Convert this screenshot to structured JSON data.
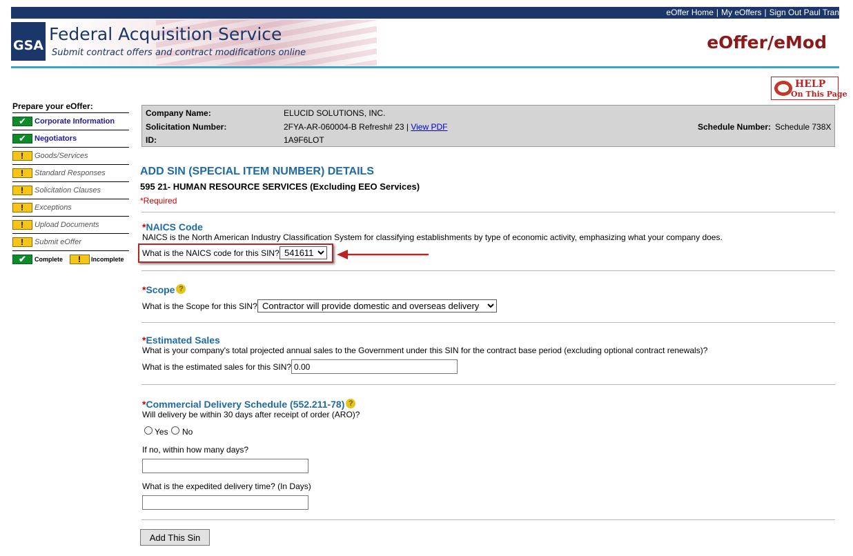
{
  "toplinks": {
    "home": "eOffer Home",
    "my": "My eOffers",
    "signout": "Sign Out Paul Tran"
  },
  "banner": {
    "logo": "GSA",
    "title": "Federal Acquisition Service",
    "subtitle": "Submit contract offers and contract modifications online",
    "brand": "eOffer/eMod"
  },
  "help": {
    "line1": "HELP",
    "line2": "On This Page"
  },
  "sidebar": {
    "title": "Prepare your eOffer:",
    "items": [
      {
        "label": "Corporate Information",
        "status": "complete"
      },
      {
        "label": "Negotiators",
        "status": "complete"
      },
      {
        "label": "Goods/Services",
        "status": "incomplete"
      },
      {
        "label": "Standard Responses",
        "status": "incomplete"
      },
      {
        "label": "Solicitation Clauses",
        "status": "incomplete"
      },
      {
        "label": "Exceptions",
        "status": "incomplete"
      },
      {
        "label": "Upload Documents",
        "status": "incomplete"
      },
      {
        "label": "Submit eOffer",
        "status": "incomplete"
      }
    ],
    "legend_complete": "Complete",
    "legend_incomplete": "Incomplete"
  },
  "info": {
    "company_label": "Company Name:",
    "company_value": "ELUCID SOLUTIONS, INC.",
    "solicitation_label": "Solicitation Number:",
    "solicitation_value": "2FYA-AR-060004-B Refresh# 23 |",
    "view_pdf": "View PDF",
    "id_label": "ID:",
    "id_value": "1A9F6LOT",
    "schedule_label": "Schedule Number:",
    "schedule_value": "Schedule 738X"
  },
  "main": {
    "title": "ADD SIN (SPECIAL ITEM NUMBER) DETAILS",
    "sin_title": "595 21- HUMAN RESOURCE SERVICES (Excluding EEO Services)",
    "required_note": "*Required"
  },
  "naics": {
    "heading": "NAICS Code",
    "description": "NAICS is the North American Industry Classification System for classifying establishments by type of economic activity, emphasizing what your company does.",
    "question": "What is the NAICS code for this SIN?",
    "selected": "541611"
  },
  "scope": {
    "heading": "Scope",
    "question": "What is the Scope for this SIN?",
    "selected": "Contractor will provide domestic and overseas delivery"
  },
  "sales": {
    "heading": "Estimated Sales",
    "description": "What is your company's total projected annual sales to the Government under this SIN for the contract base period (excluding optional contract renewals)?",
    "question": "What is the estimated sales for this SIN?",
    "value": "0.00"
  },
  "delivery": {
    "heading": "Commercial Delivery Schedule (552.211-78)",
    "question": "Will delivery be within 30 days after receipt of order (ARO)?",
    "yes": "Yes",
    "no": "No",
    "days_label": "If no, within how many days?",
    "expedited_label": "What is the expedited delivery time? (In Days)"
  },
  "actions": {
    "add_label": "Add This Sin"
  },
  "colors": {
    "navy": "#1b3668",
    "accent": "#1f6aa3",
    "required": "#c00",
    "brand": "#8b1a1a"
  }
}
